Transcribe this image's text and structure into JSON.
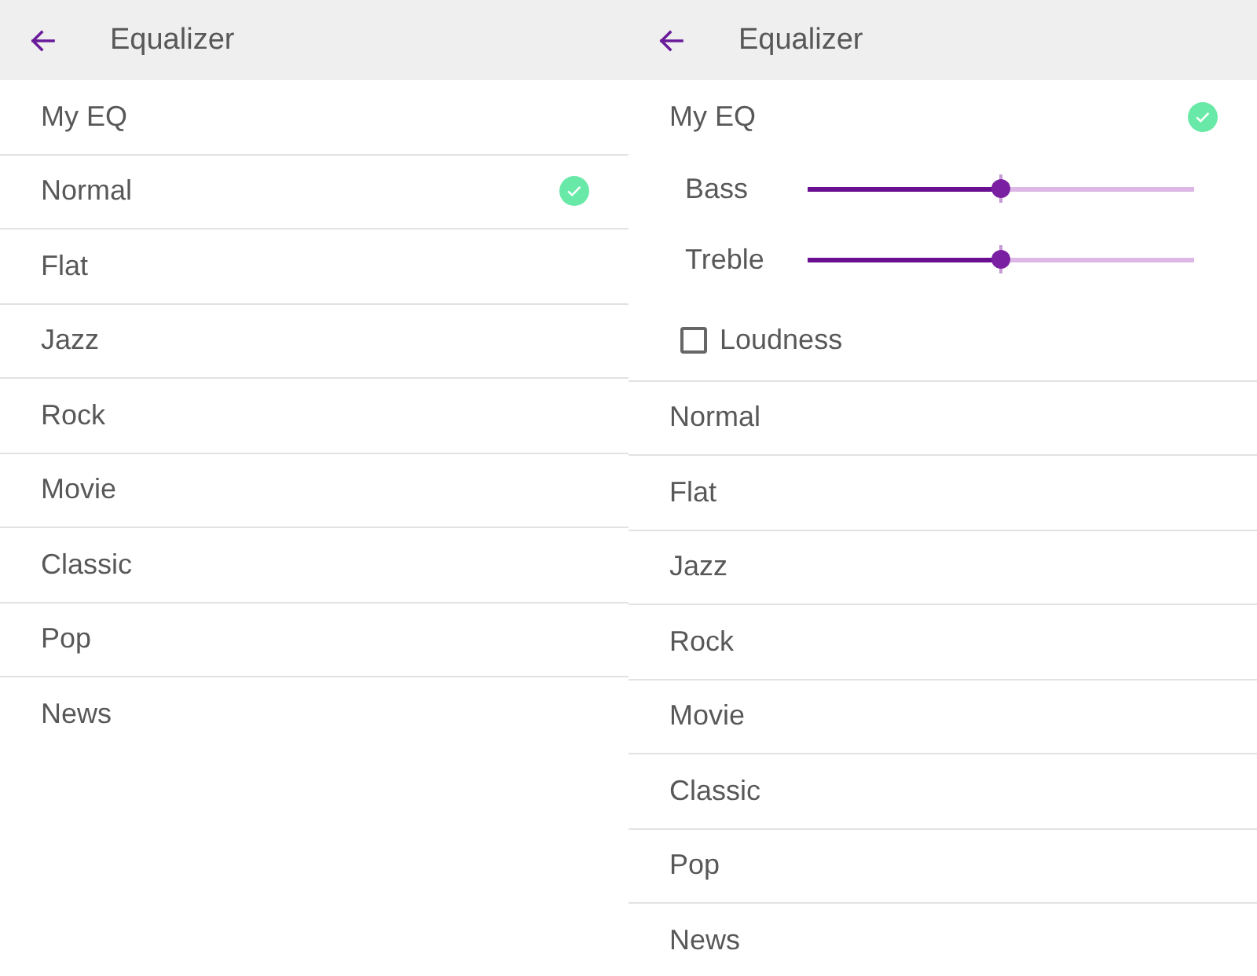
{
  "panels": [
    {
      "app_bar": {
        "title": "Equalizer"
      },
      "presets": [
        {
          "label": "My EQ",
          "selected": false
        },
        {
          "label": "Normal",
          "selected": true
        },
        {
          "label": "Flat",
          "selected": false
        },
        {
          "label": "Jazz",
          "selected": false
        },
        {
          "label": "Rock",
          "selected": false
        },
        {
          "label": "Movie",
          "selected": false
        },
        {
          "label": "Classic",
          "selected": false
        },
        {
          "label": "Pop",
          "selected": false
        },
        {
          "label": "News",
          "selected": false
        }
      ]
    },
    {
      "app_bar": {
        "title": "Equalizer"
      },
      "presets": [
        {
          "label": "My EQ",
          "selected": true,
          "settings": [
            {
              "kind": "slider",
              "label": "Bass",
              "level": 0.5
            },
            {
              "kind": "slider",
              "label": "Treble",
              "level": 0.5
            },
            {
              "kind": "checkbox",
              "label": "Loudness",
              "checked": false
            }
          ]
        },
        {
          "label": "Normal",
          "selected": false
        },
        {
          "label": "Flat",
          "selected": false
        },
        {
          "label": "Jazz",
          "selected": false
        },
        {
          "label": "Rock",
          "selected": false
        },
        {
          "label": "Movie",
          "selected": false
        },
        {
          "label": "Classic",
          "selected": false
        },
        {
          "label": "Pop",
          "selected": false
        },
        {
          "label": "News",
          "selected": false
        }
      ]
    }
  ]
}
